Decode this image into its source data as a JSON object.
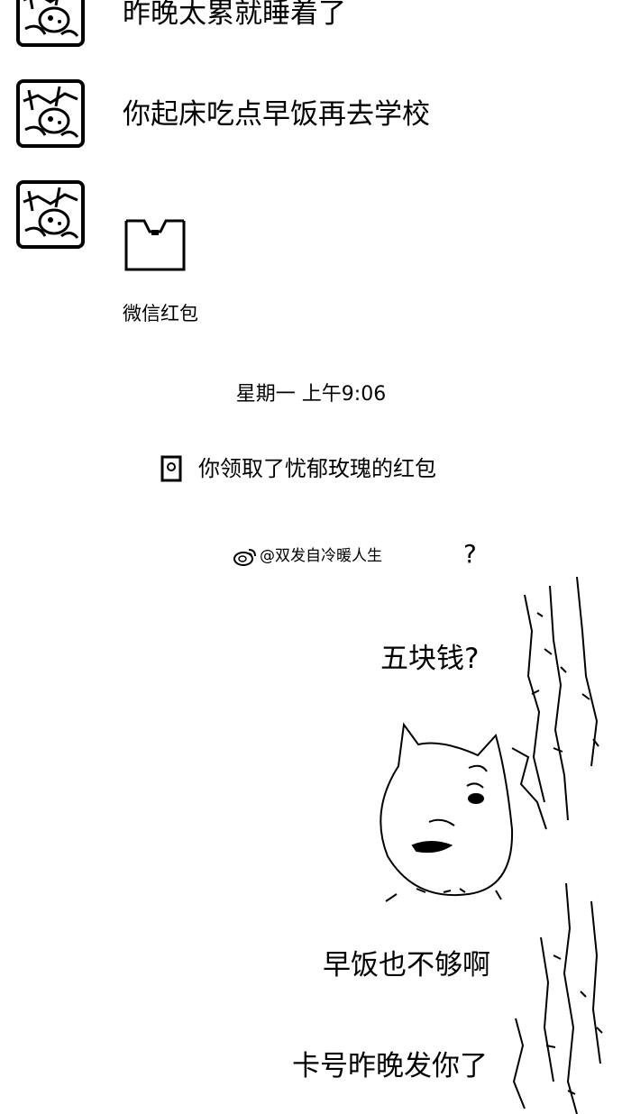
{
  "chat": {
    "messages": [
      {
        "type": "text",
        "text": "昨晚太累就睡着了"
      },
      {
        "type": "text",
        "text": "你起床吃点早饭再去学校"
      },
      {
        "type": "red_packet",
        "label": "微信红包"
      }
    ],
    "timestamp": "星期一 上午9:06",
    "system_notice": "你领取了忧郁玫瑰的红包"
  },
  "meme": {
    "watermark": "@双发自冷暖人生",
    "question_mark": "?",
    "lines": [
      "五块钱?",
      "早饭也不够啊",
      "卡号昨晚发你了"
    ]
  },
  "icons": {
    "avatar": "avatar-icon",
    "red_packet": "red-packet-icon",
    "system": "red-packet-small-icon",
    "watermark": "weibo-icon"
  }
}
